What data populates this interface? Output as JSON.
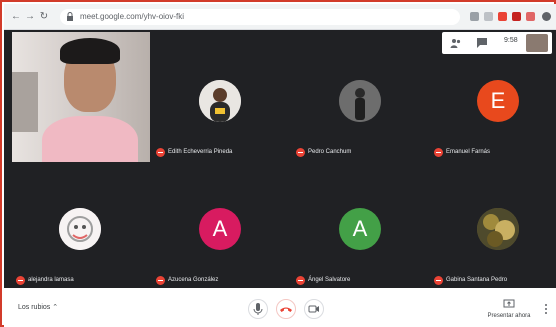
{
  "browser": {
    "url": "meet.google.com/yhv-oiov-fki",
    "accent": "#d23b2a"
  },
  "status": {
    "time": "9:58"
  },
  "participants": [
    {
      "name": "Edith Echeverria Pineda",
      "avatar": "photo",
      "color": "#efefef",
      "muted": true
    },
    {
      "name": "Pedro Canchum",
      "avatar": "photo",
      "color": "#5a5a5a",
      "muted": true
    },
    {
      "name": "Emanuel Farnás",
      "avatar": "letter",
      "letter": "E",
      "color": "#e8491d",
      "muted": true
    },
    {
      "name": "alejandra lamasa",
      "avatar": "photo",
      "color": "#f3eeee",
      "muted": true
    },
    {
      "name": "Azucena González",
      "avatar": "letter",
      "letter": "A",
      "color": "#d81b60",
      "muted": true
    },
    {
      "name": "Ángel Salvatore",
      "avatar": "letter",
      "letter": "A",
      "color": "#43a047",
      "muted": true
    },
    {
      "name": "Gabina Santana Pedro",
      "avatar": "photo",
      "color": "#7a6a3a",
      "muted": true
    }
  ],
  "bottom": {
    "meeting_details": "Los rubios",
    "present_label": "Presentar ahora"
  }
}
